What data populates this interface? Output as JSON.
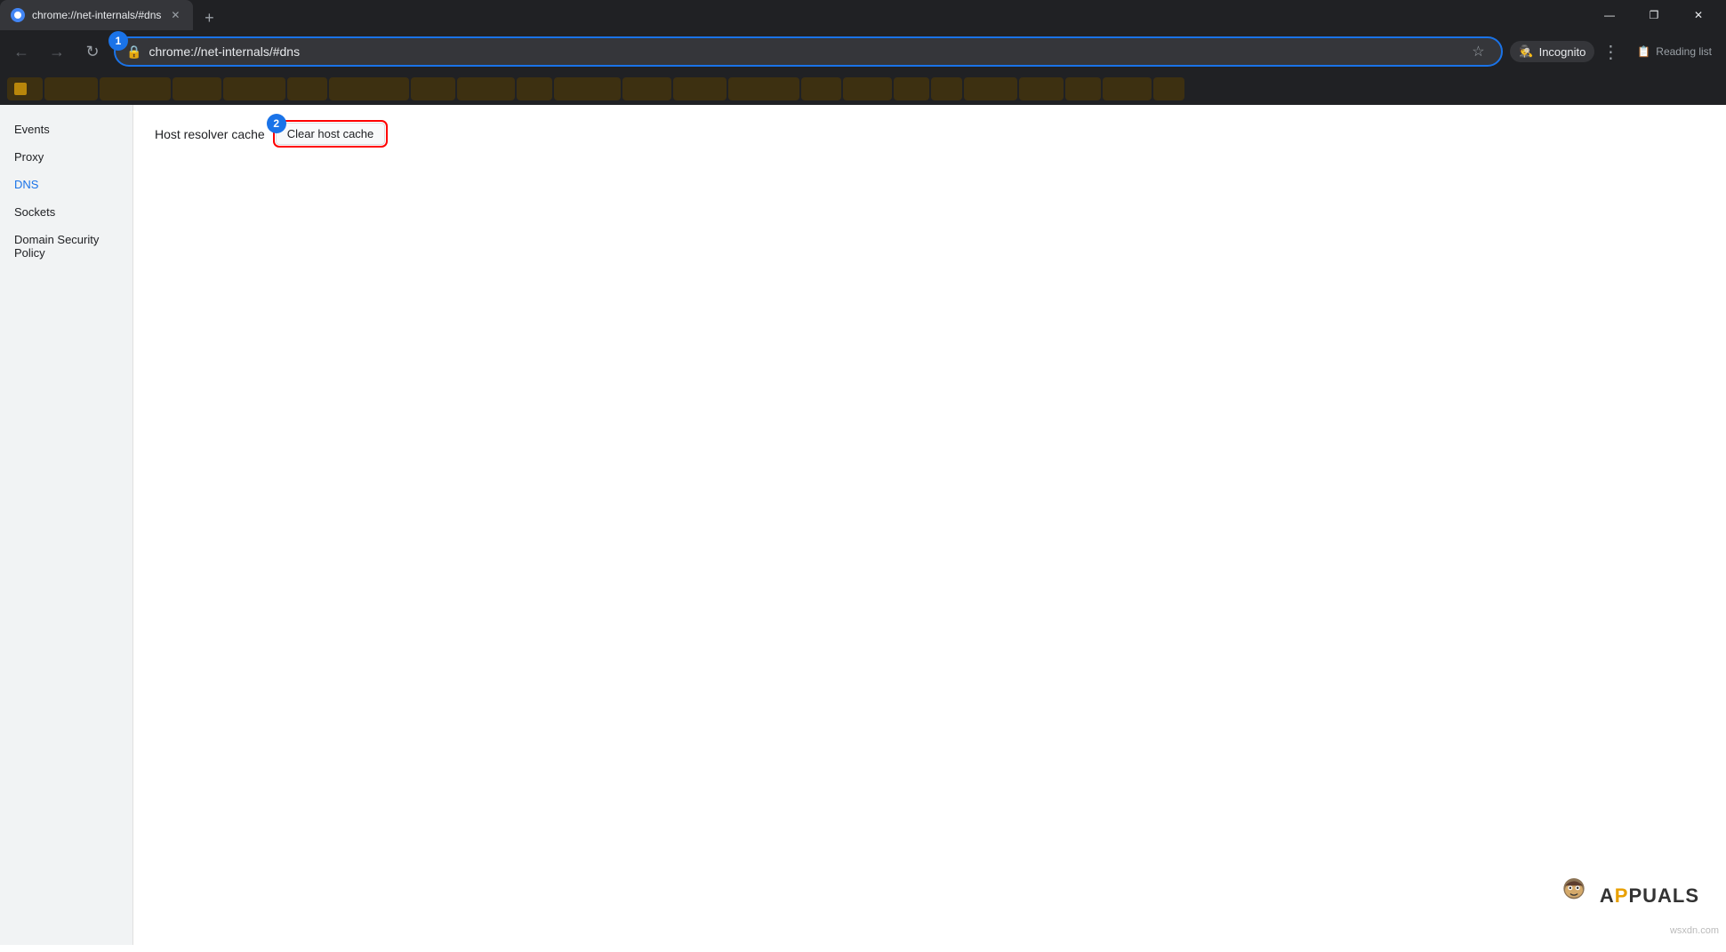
{
  "browser": {
    "tab": {
      "title": "chrome://net-internals/#dns",
      "favicon_label": "chrome-tab-favicon"
    },
    "address_bar": {
      "url": "chrome://net-internals/#dns",
      "icon": "🔒"
    },
    "incognito_label": "Incognito",
    "reading_list_label": "Reading list",
    "window_controls": {
      "minimize": "—",
      "maximize": "❐",
      "close": "✕"
    }
  },
  "annotations": {
    "badge1_number": "1",
    "badge2_number": "2"
  },
  "sidebar": {
    "items": [
      {
        "label": "Events",
        "active": false
      },
      {
        "label": "Proxy",
        "active": false
      },
      {
        "label": "DNS",
        "active": true
      },
      {
        "label": "Sockets",
        "active": false
      },
      {
        "label": "Domain Security Policy",
        "active": false
      }
    ]
  },
  "main": {
    "host_resolver_label": "Host resolver cache",
    "clear_button_label": "Clear host cache"
  },
  "watermark": {
    "site": "wsxdn.com"
  },
  "appuals": {
    "text": "APPUALS"
  }
}
